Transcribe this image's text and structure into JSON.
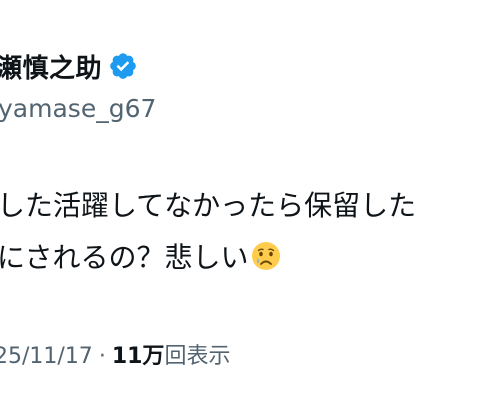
{
  "post": {
    "display_name": "瀬慎之助",
    "username": "yamase_g67",
    "verified_icon": "verified-badge-icon",
    "body_line_1": "した活躍してなかったら保留した",
    "body_line_2": "にされるの？悲しい",
    "body_emoji": "crying-face-icon",
    "date": "25/11/17",
    "separator": "·",
    "views_count": "11万",
    "views_label": "回表示",
    "colors": {
      "text": "#0f1419",
      "secondary": "#536471",
      "verified": "#1d9bf0"
    }
  }
}
